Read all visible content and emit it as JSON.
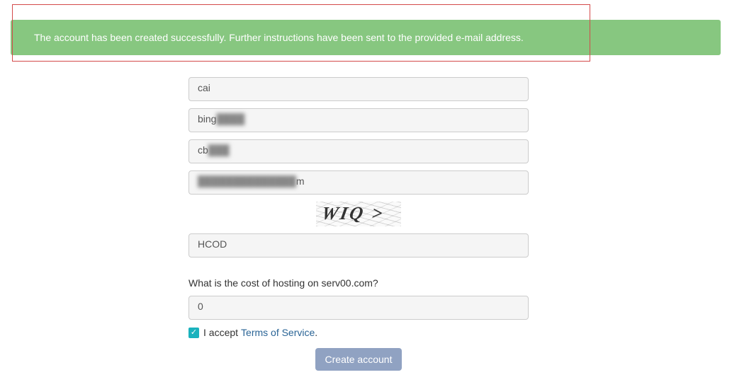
{
  "alert": {
    "message": "The account has been created successfully. Further instructions have been sent to the provided e-mail address."
  },
  "form": {
    "first_name": "cai",
    "last_name_visible": "bing",
    "last_name_blurred": "████",
    "username_visible": "cb",
    "username_blurred": "███",
    "email_blurred": "██████████████",
    "email_suffix": "m",
    "captcha_display": "WIQ >",
    "captcha_input": "HCOD",
    "question_label": "What is the cost of hosting on serv00.com?",
    "question_answer": "0",
    "accept_prefix": "I accept",
    "tos_label": "Terms of Service",
    "period": ".",
    "submit_label": "Create account"
  }
}
